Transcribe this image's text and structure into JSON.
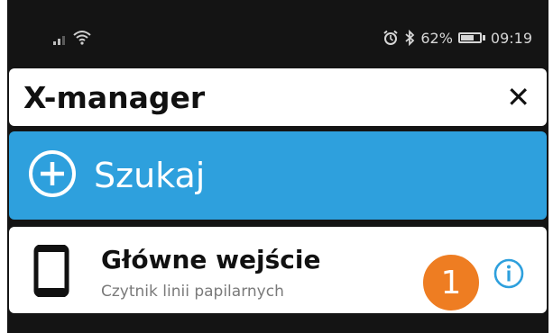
{
  "status_bar": {
    "icons": [
      "signal-icon",
      "wifi-icon",
      "alarm-icon",
      "bluetooth-icon",
      "battery-icon"
    ],
    "battery_percent": "62%",
    "battery_level": 0.62,
    "time": "09:19"
  },
  "search": {
    "value": "X-manager",
    "clear_label": "✕"
  },
  "szukaj_button": {
    "label": "Szukaj",
    "icon": "plus-circle-icon",
    "color": "#2ea0dd"
  },
  "device_list": [
    {
      "title": "Główne wejście",
      "subtitle": "Czytnik linii papilarnych",
      "icon": "phone-icon",
      "badge": "1",
      "badge_color": "#ee7d22",
      "info_icon": "info-icon"
    }
  ]
}
